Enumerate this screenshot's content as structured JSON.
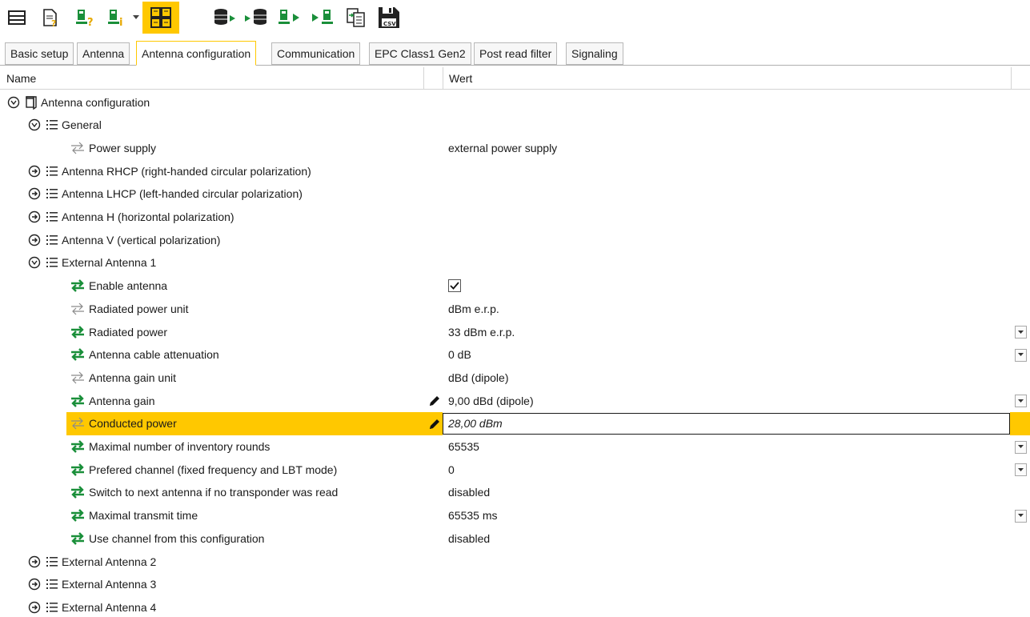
{
  "toolbar": {
    "buttons": [
      {
        "name": "layout-panel-icon"
      },
      {
        "name": "document-help-icon"
      },
      {
        "name": "reader-help-icon"
      },
      {
        "name": "reader-info-icon"
      },
      {
        "name": "dropdown-arrow-icon"
      },
      {
        "name": "config-grid-icon"
      },
      {
        "name": "database-play-icon"
      },
      {
        "name": "play-database-icon"
      },
      {
        "name": "reader-play-icon"
      },
      {
        "name": "play-reader-icon"
      },
      {
        "name": "import-export-icon"
      },
      {
        "name": "save-csv-icon"
      }
    ],
    "csv_label": "CSV"
  },
  "tabs": [
    {
      "label": "Basic setup"
    },
    {
      "label": "Antenna"
    },
    {
      "label": "Antenna configuration"
    },
    {
      "label": "Communication"
    },
    {
      "label": "EPC Class1 Gen2"
    },
    {
      "label": "Post read filter"
    },
    {
      "label": "Signaling"
    }
  ],
  "grid": {
    "col_name": "Name",
    "col_value": "Wert"
  },
  "rows": [
    {
      "name": "Antenna configuration",
      "value": "",
      "kind": "root"
    },
    {
      "name": "General",
      "value": "",
      "kind": "group-open"
    },
    {
      "name": "Power supply",
      "value": "external power supply",
      "kind": "prop-ro"
    },
    {
      "name": "Antenna RHCP (right-handed circular polarization)",
      "value": "",
      "kind": "group-closed"
    },
    {
      "name": "Antenna LHCP (left-handed circular polarization)",
      "value": "",
      "kind": "group-closed"
    },
    {
      "name": "Antenna H (horizontal polarization)",
      "value": "",
      "kind": "group-closed"
    },
    {
      "name": "Antenna V (vertical polarization)",
      "value": "",
      "kind": "group-closed"
    },
    {
      "name": "External Antenna 1",
      "value": "",
      "kind": "group-open"
    },
    {
      "name": "Enable antenna",
      "value": "",
      "kind": "prop-check"
    },
    {
      "name": "Radiated power unit",
      "value": "dBm e.r.p.",
      "kind": "prop-ro"
    },
    {
      "name": "Radiated power",
      "value": "33 dBm e.r.p.",
      "kind": "prop-dd"
    },
    {
      "name": "Antenna cable attenuation",
      "value": "0 dB",
      "kind": "prop-dd"
    },
    {
      "name": "Antenna gain unit",
      "value": "dBd (dipole)",
      "kind": "prop-ro"
    },
    {
      "name": "Antenna gain",
      "value": "9,00 dBd (dipole)",
      "kind": "prop-dd-pen"
    },
    {
      "name": "Conducted power",
      "value": "28,00 dBm",
      "kind": "prop-edit"
    },
    {
      "name": "Maximal number of inventory rounds",
      "value": "65535",
      "kind": "prop-dd"
    },
    {
      "name": "Prefered channel  (fixed frequency and LBT mode)",
      "value": "0",
      "kind": "prop-dd"
    },
    {
      "name": "Switch to next antenna if no transponder was read",
      "value": "disabled",
      "kind": "prop"
    },
    {
      "name": "Maximal transmit time",
      "value": "65535 ms",
      "kind": "prop-dd"
    },
    {
      "name": "Use channel from this configuration",
      "value": "disabled",
      "kind": "prop"
    },
    {
      "name": "External Antenna 2",
      "value": "",
      "kind": "group-closed"
    },
    {
      "name": "External Antenna 3",
      "value": "",
      "kind": "group-closed"
    },
    {
      "name": "External Antenna 4",
      "value": "",
      "kind": "group-closed"
    }
  ],
  "colors": {
    "accent": "#ffc800",
    "green_arrows": "#1a8f3a",
    "gray_icon": "#8a8a8a"
  }
}
